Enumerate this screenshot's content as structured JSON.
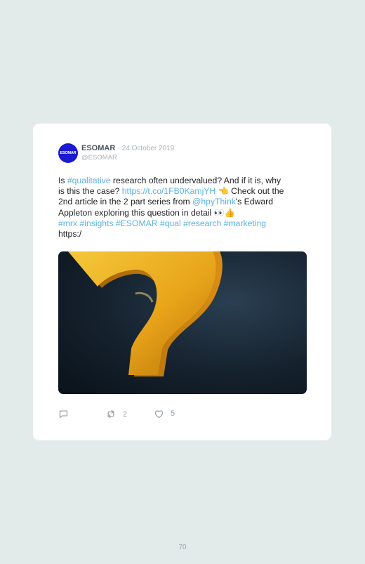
{
  "tweet": {
    "avatar_text": "ESOMAR",
    "name": "ESOMAR",
    "separator": "·",
    "date": "24 October 2019",
    "handle": "@ESOMAR",
    "body": {
      "t1": "Is ",
      "link1": "#qualitative",
      "t2": " research often undervalued? And if it is, why",
      "t3": "is this the case? ",
      "link2": "https://t.co/1FB0KamjYH",
      "emoji1": " 👈",
      "t4": " Check out the",
      "t5": "2nd article in the 2 part series from ",
      "link3": "@hpyThink",
      "t6": "'s Edward",
      "t7": "Appleton exploring this question in detail ",
      "emoji2": "👀👍",
      "hashtags": "#mrx #insights #ESOMAR #qual #research #marketing",
      "t8": "https:/"
    },
    "image_description": "question-mark-image",
    "actions": {
      "reply_count": "",
      "retweet_count": "2",
      "like_count": "5"
    }
  },
  "page_number": "70",
  "colors": {
    "background": "#e3ebea",
    "link": "#5ab3e3",
    "avatar": "#1a1ad0",
    "icon": "#9aa3ab"
  }
}
